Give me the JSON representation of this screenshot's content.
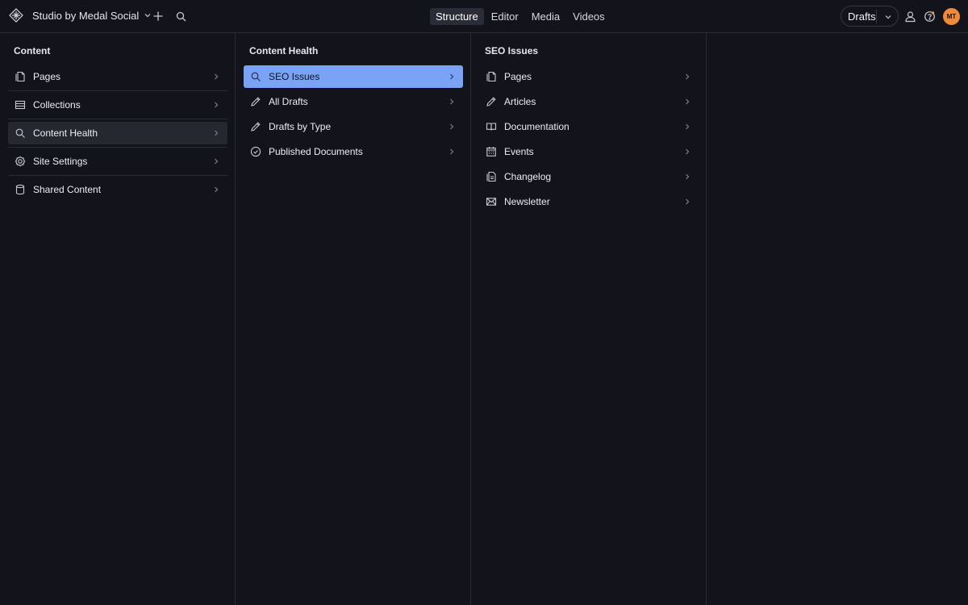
{
  "header": {
    "workspace_title": "Studio by Medal Social",
    "nav_tabs": [
      {
        "label": "Structure",
        "active": true
      },
      {
        "label": "Editor",
        "active": false
      },
      {
        "label": "Media",
        "active": false
      },
      {
        "label": "Videos",
        "active": false
      }
    ],
    "perspective_select": "Drafts",
    "avatar_initials": "MT",
    "avatar_color": "#f08a3c"
  },
  "panes": [
    {
      "title": "Content",
      "items": [
        {
          "label": "Pages",
          "icon": "document-icon"
        },
        {
          "label": "Collections",
          "icon": "list-icon"
        },
        {
          "label": "Content Health",
          "icon": "search-icon",
          "state": "hover"
        },
        {
          "label": "Site Settings",
          "icon": "gear-icon"
        },
        {
          "label": "Shared Content",
          "icon": "database-icon"
        }
      ]
    },
    {
      "title": "Content Health",
      "items": [
        {
          "label": "SEO Issues",
          "icon": "search-icon",
          "state": "selected"
        },
        {
          "label": "All Drafts",
          "icon": "pencil-icon"
        },
        {
          "label": "Drafts by Type",
          "icon": "pencil-icon"
        },
        {
          "label": "Published Documents",
          "icon": "check-circle-icon"
        }
      ]
    },
    {
      "title": "SEO Issues",
      "items": [
        {
          "label": "Pages",
          "icon": "document-icon"
        },
        {
          "label": "Articles",
          "icon": "pencil-icon"
        },
        {
          "label": "Documentation",
          "icon": "book-icon"
        },
        {
          "label": "Events",
          "icon": "calendar-icon"
        },
        {
          "label": "Changelog",
          "icon": "document-text-icon"
        },
        {
          "label": "Newsletter",
          "icon": "envelope-icon"
        }
      ]
    }
  ],
  "colors": {
    "background": "#13141b",
    "selected": "#7aa2f5",
    "hover": "#252731",
    "border": "#2a2c35"
  }
}
